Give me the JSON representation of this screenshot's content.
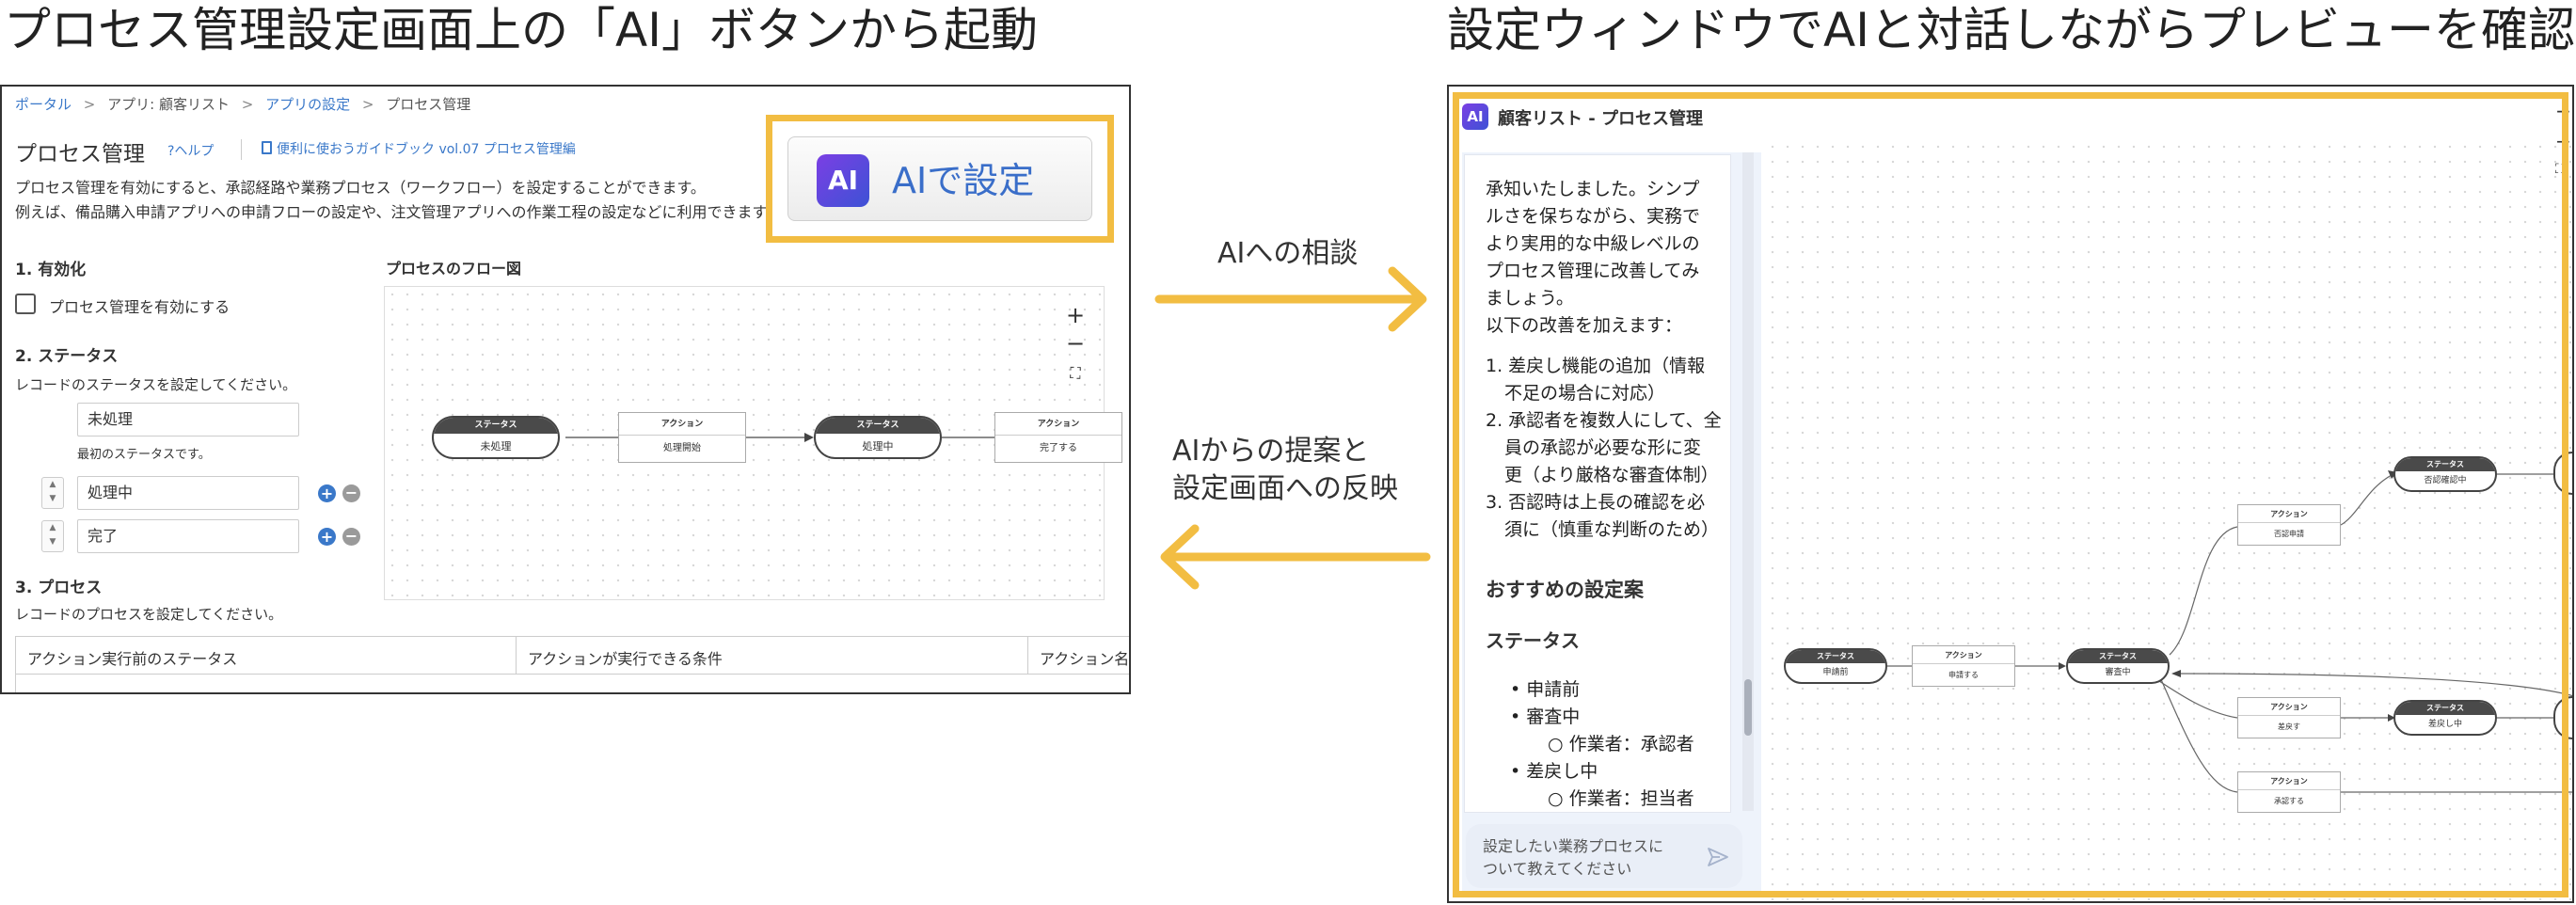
{
  "captions": {
    "left": "プロセス管理設定画面上の「AI」ボタンから起動",
    "right": "設定ウィンドウでAIと対話しながらプレビューを確認"
  },
  "arrows": {
    "forward_label": "AIへの相談",
    "back_label_line1": "AIからの提案と",
    "back_label_line2": "設定画面への反映"
  },
  "left_panel": {
    "breadcrumb": {
      "portal": "ポータル",
      "sep": ">",
      "app": "アプリ: 顧客リスト",
      "app_settings": "アプリの設定",
      "current": "プロセス管理"
    },
    "page_title": "プロセス管理",
    "help_link": "?ヘルプ",
    "guide_link": "便利に使おうガイドブック vol.07 プロセス管理編",
    "description_line1": "プロセス管理を有効にすると、承認経路や業務プロセス（ワークフロー）を設定することができます。",
    "description_line2": "例えば、備品購入申請アプリへの申請フローの設定や、注文管理アプリへの作業工程の設定などに利用できます。",
    "ai_button_label": "AIで設定",
    "ai_logo": "AI",
    "section1": {
      "title": "1. 有効化",
      "checkbox_label": "プロセス管理を有効にする"
    },
    "section2": {
      "title": "2. ステータス",
      "description": "レコードのステータスを設定してください。",
      "first_status": "未処理",
      "first_note": "最初のステータスです。",
      "statuses": [
        "処理中",
        "完了"
      ]
    },
    "flow": {
      "title": "プロセスのフロー図",
      "status_header": "ステータス",
      "action_header": "アクション",
      "nodes": {
        "s1": "未処理",
        "a1": "処理開始",
        "s2": "処理中",
        "a2": "完了する"
      }
    },
    "section3": {
      "title": "3. プロセス",
      "description": "レコードのプロセスを設定してください。",
      "columns": [
        "アクション実行前のステータス",
        "アクションが実行できる条件",
        "アクション名"
      ]
    }
  },
  "right_panel": {
    "window_title": "顧客リスト - プロセス管理",
    "logo": "AI",
    "chat": {
      "intro": [
        "承知いたしました。シンプ",
        "ルさを保ちながら、実務で",
        "より実用的な中級レベルの",
        "プロセス管理に改善してみ",
        "ましょう。",
        "以下の改善を加えます："
      ],
      "items": [
        [
          "1. 差戻し機能の追加（情報",
          "不足の場合に対応）"
        ],
        [
          "2. 承認者を複数人にして、全",
          "員の承認が必要な形に変",
          "更（より厳格な審査体制）"
        ],
        [
          "3. 否認時は上長の確認を必",
          "須に（慎重な判断のため）"
        ]
      ],
      "heading": "おすすめの設定案",
      "subheading": "ステータス",
      "status_list": [
        {
          "label": "申請前"
        },
        {
          "label": "審査中",
          "sub": "作業者：承認者"
        },
        {
          "label": "差戻し中",
          "sub": "作業者：担当者"
        }
      ],
      "input_placeholder_line1": "設定したい業務プロセスに",
      "input_placeholder_line2": "ついて教えてください"
    },
    "flow": {
      "status_header": "ステータス",
      "action_header": "アクション",
      "s_apply_before": "申請前",
      "a_apply": "申請する",
      "s_review": "審査中",
      "a_reject_apply": "否認申請",
      "s_reject_confirm": "否認確認中",
      "a_return": "差戻す",
      "s_returned": "差戻し中",
      "a_approve": "承認する"
    }
  },
  "colors": {
    "highlight": "#f2bd42",
    "link": "#3a78c9",
    "ai_logo_gradient_start": "#7b3fe4",
    "ai_logo_gradient_end": "#3d52d5"
  }
}
